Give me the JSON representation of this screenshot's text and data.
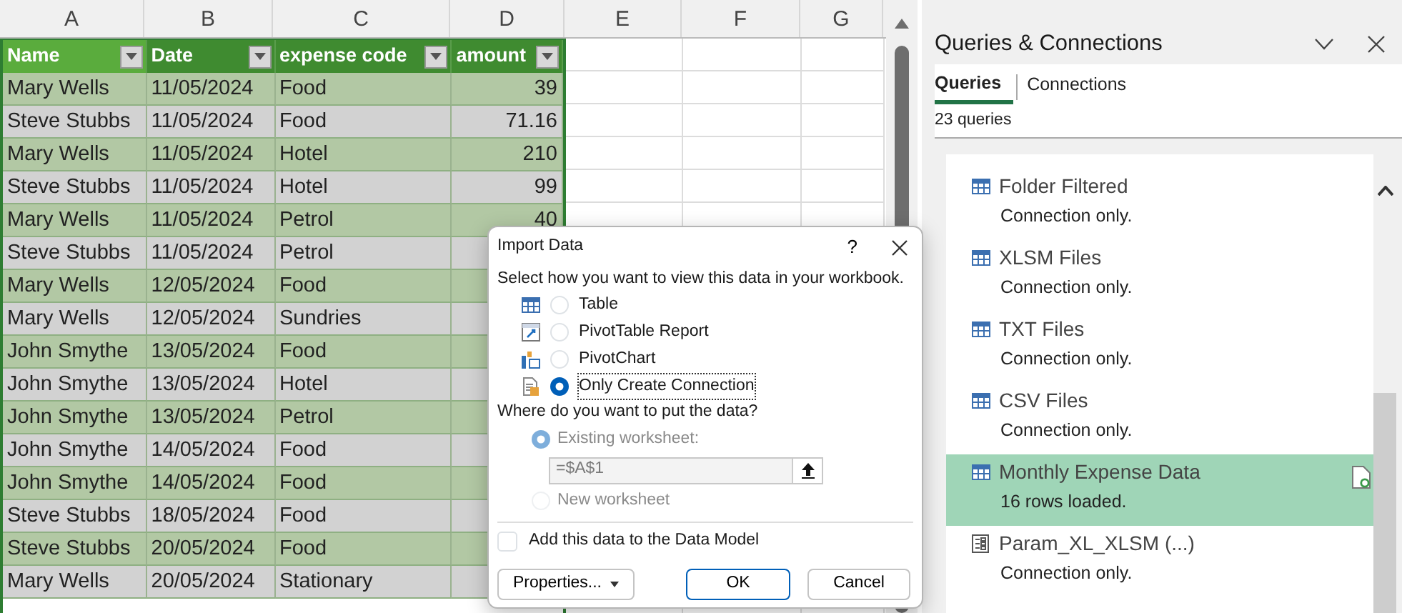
{
  "sheet": {
    "column_headers": [
      "A",
      "B",
      "C",
      "D",
      "E",
      "F",
      "G"
    ],
    "table": {
      "columns": [
        "Name",
        "Date",
        "expense code",
        "amount"
      ],
      "rows": [
        {
          "cells": [
            "Mary Wells",
            "11/05/2024",
            "Food",
            "39"
          ]
        },
        {
          "cells": [
            "Steve Stubbs",
            "11/05/2024",
            "Food",
            "71.16"
          ]
        },
        {
          "cells": [
            "Mary Wells",
            "11/05/2024",
            "Hotel",
            "210"
          ]
        },
        {
          "cells": [
            "Steve Stubbs",
            "11/05/2024",
            "Hotel",
            "99"
          ]
        },
        {
          "cells": [
            "Mary Wells",
            "11/05/2024",
            "Petrol",
            "40"
          ]
        },
        {
          "cells": [
            "Steve Stubbs",
            "11/05/2024",
            "Petrol"
          ]
        },
        {
          "cells": [
            "Mary Wells",
            "12/05/2024",
            "Food"
          ]
        },
        {
          "cells": [
            "Mary Wells",
            "12/05/2024",
            "Sundries"
          ]
        },
        {
          "cells": [
            "John Smythe",
            "13/05/2024",
            "Food"
          ]
        },
        {
          "cells": [
            "John Smythe",
            "13/05/2024",
            "Hotel"
          ]
        },
        {
          "cells": [
            "John Smythe",
            "13/05/2024",
            "Petrol"
          ]
        },
        {
          "cells": [
            "John Smythe",
            "14/05/2024",
            "Food"
          ]
        },
        {
          "cells": [
            "John Smythe",
            "14/05/2024",
            "Food"
          ]
        },
        {
          "cells": [
            "Steve Stubbs",
            "18/05/2024",
            "Food"
          ]
        },
        {
          "cells": [
            "Steve Stubbs",
            "20/05/2024",
            "Food"
          ]
        },
        {
          "cells": [
            "Mary Wells",
            "20/05/2024",
            "Stationary"
          ]
        }
      ]
    }
  },
  "dialog": {
    "title": "Import Data",
    "help": "?",
    "view_prompt": "Select how you want to view this data in your workbook.",
    "view_options": [
      {
        "label": "Table",
        "kind": "table",
        "selected": false
      },
      {
        "label": "PivotTable Report",
        "kind": "pivottable",
        "selected": false
      },
      {
        "label": "PivotChart",
        "kind": "pivotchart",
        "selected": false
      },
      {
        "label": "Only Create Connection",
        "kind": "connection",
        "selected": true
      }
    ],
    "location_prompt": "Where do you want to put the data?",
    "location_options": [
      {
        "label": "Existing worksheet:",
        "selected": true,
        "disabled": true,
        "field": "=$A$1"
      },
      {
        "label": "New worksheet",
        "selected": false,
        "disabled": true
      }
    ],
    "data_model": {
      "label": "Add this data to the Data Model",
      "checked": false
    },
    "buttons": [
      {
        "label": "Properties...",
        "kind": "dropdown"
      },
      {
        "label": "OK",
        "kind": "default"
      },
      {
        "label": "Cancel",
        "kind": "plain"
      }
    ]
  },
  "panel": {
    "title": "Queries & Connections",
    "tabs": [
      {
        "label": "Queries",
        "selected": true
      },
      {
        "label": "Connections",
        "selected": false
      }
    ],
    "count": "23 queries",
    "items": [
      {
        "name": "Folder Filtered",
        "status": "Connection only.",
        "kind": "table",
        "selected": false
      },
      {
        "name": "XLSM Files",
        "status": "Connection only.",
        "kind": "table",
        "selected": false
      },
      {
        "name": "TXT Files",
        "status": "Connection only.",
        "kind": "table",
        "selected": false
      },
      {
        "name": "CSV Files",
        "status": "Connection only.",
        "kind": "table",
        "selected": false
      },
      {
        "name": "Monthly Expense Data",
        "status": "16 rows loaded.",
        "kind": "table",
        "selected": true
      },
      {
        "name": "Param_XL_XLSM (...)",
        "status": "Connection only.",
        "kind": "parameter",
        "selected": false
      }
    ]
  }
}
